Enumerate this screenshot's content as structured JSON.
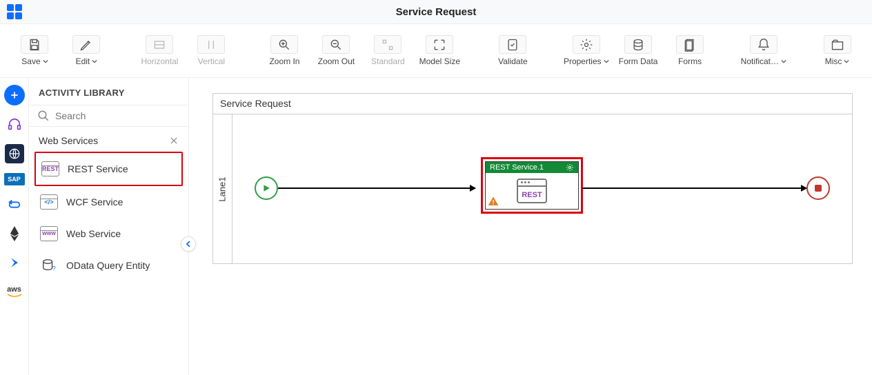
{
  "header": {
    "title": "Service Request"
  },
  "toolbar": [
    {
      "id": "save",
      "label": "Save",
      "dropdown": true,
      "disabled": false
    },
    {
      "id": "edit",
      "label": "Edit",
      "dropdown": true,
      "disabled": false
    },
    {
      "id": "horizontal",
      "label": "Horizontal",
      "dropdown": false,
      "disabled": true
    },
    {
      "id": "vertical",
      "label": "Vertical",
      "dropdown": false,
      "disabled": true
    },
    {
      "id": "zoomin",
      "label": "Zoom In",
      "dropdown": false,
      "disabled": false
    },
    {
      "id": "zoomout",
      "label": "Zoom Out",
      "dropdown": false,
      "disabled": false
    },
    {
      "id": "standard",
      "label": "Standard",
      "dropdown": false,
      "disabled": true
    },
    {
      "id": "modelsize",
      "label": "Model Size",
      "dropdown": false,
      "disabled": false
    },
    {
      "id": "validate",
      "label": "Validate",
      "dropdown": false,
      "disabled": false
    },
    {
      "id": "properties",
      "label": "Properties",
      "dropdown": true,
      "disabled": false
    },
    {
      "id": "formdata",
      "label": "Form Data",
      "dropdown": false,
      "disabled": false
    },
    {
      "id": "forms",
      "label": "Forms",
      "dropdown": false,
      "disabled": false
    },
    {
      "id": "notifications",
      "label": "Notificat…",
      "dropdown": true,
      "disabled": false
    },
    {
      "id": "misc",
      "label": "Misc",
      "dropdown": true,
      "disabled": false
    }
  ],
  "sidebar": {
    "title": "ACTIVITY LIBRARY",
    "search_placeholder": "Search",
    "category": "Web Services",
    "items": [
      {
        "label": "REST Service",
        "highlight": true
      },
      {
        "label": "WCF Service",
        "highlight": false
      },
      {
        "label": "Web Service",
        "highlight": false
      },
      {
        "label": "OData Query Entity",
        "highlight": false
      }
    ]
  },
  "leftrail": {
    "items": [
      "headset",
      "globe",
      "sap",
      "loop",
      "eth",
      "blob",
      "aws"
    ]
  },
  "canvas": {
    "model_title": "Service Request",
    "lane_label": "Lane1",
    "rest_node_title": "REST Service.1",
    "rest_body_label": "REST"
  }
}
